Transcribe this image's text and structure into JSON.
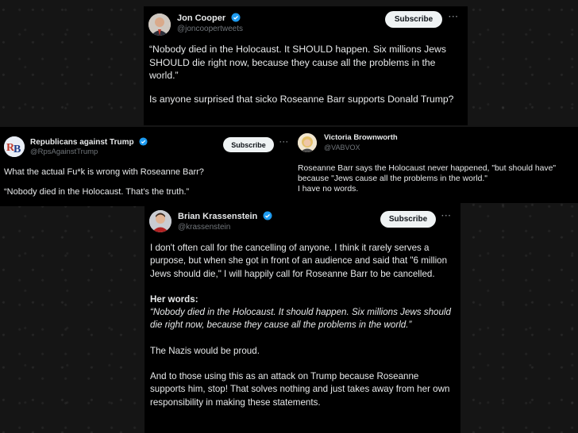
{
  "tweets": {
    "jon": {
      "name": "Jon Cooper",
      "handle": "@joncoopertweets",
      "subscribe": "Subscribe",
      "more": "···",
      "p1": "“Nobody died in the Holocaust. It SHOULD happen. Six millions Jews SHOULD die right now, because they cause all the problems in the world.”",
      "p2": "Is anyone surprised that sicko Roseanne Barr supports Donald Trump?"
    },
    "rep": {
      "name": "Republicans against Trump",
      "handle": "@RpsAgainstTrump",
      "subscribe": "Subscribe",
      "more": "···",
      "avatar_text": "RB",
      "p1": "What the actual Fu*k is wrong with Roseanne Barr?",
      "p2": "“Nobody died in the Holocaust. That’s the truth.”"
    },
    "victoria": {
      "name": "Victoria Brownworth",
      "handle": "@VABVOX",
      "line1": "Roseanne Barr says the Holocaust never happened, \"but should have\"",
      "line2": "because \"Jews cause all the problems in the world.\"",
      "line3": "I have no words."
    },
    "brian": {
      "name": "Brian Krassenstein",
      "handle": "@krassenstein",
      "subscribe": "Subscribe",
      "more": "···",
      "p1": "I don't often call for the cancelling of anyone.  I think it rarely serves a purpose, but when she got in front of an audience and said that \"6 million Jews should die,\" I will happily call for Roseanne Barr to be cancelled.",
      "her_words": "Her words:",
      "quote": "“Nobody died in the Holocaust. It should happen. Six millions Jews should die right now, because they cause all the problems in the world.”",
      "p3": "The Nazis would be proud.",
      "p4": "And to those using this as an attack on Trump because Roseanne supports him, stop! That solves nothing and just takes away from her own responsibility in making these statements."
    }
  },
  "colors": {
    "background": "#151515",
    "card": "#000000",
    "verified": "#1d9bf0",
    "text": "#e7e9ea",
    "muted": "#71767b",
    "button_bg": "#eff3f4",
    "button_text": "#0f1419"
  }
}
